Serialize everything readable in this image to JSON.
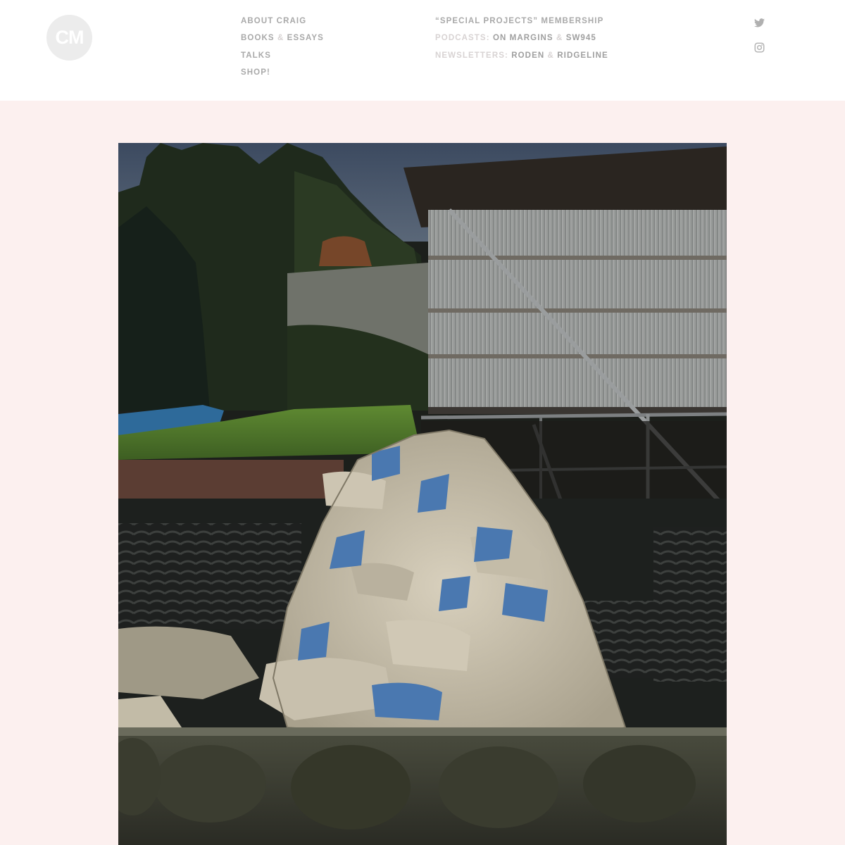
{
  "site": {
    "logo_text": "CM"
  },
  "nav": {
    "left": [
      {
        "label": "ABOUT CRAIG"
      },
      {
        "label_a": "BOOKS",
        "amp": "&",
        "label_b": "ESSAYS"
      },
      {
        "label": "TALKS"
      },
      {
        "label": "SHOP!"
      }
    ],
    "right": [
      {
        "label": "“SPECIAL PROJECTS” MEMBERSHIP"
      },
      {
        "prefix": "PODCASTS:",
        "link_a": "ON MARGINS",
        "amp": "&",
        "link_b": "SW945"
      },
      {
        "prefix": "NEWSLETTERS:",
        "link_a": "RODEN",
        "amp": "&",
        "link_b": "RIDGELINE"
      }
    ]
  },
  "social": {
    "icons": [
      "twitter-icon",
      "instagram-icon"
    ]
  },
  "colors": {
    "page_background": "#fcf0ef",
    "header_background": "#ffffff",
    "nav_text": "#a9a9a9",
    "logo_background": "#ececec"
  },
  "photo": {
    "subject": "photo-sandbag-pile"
  }
}
